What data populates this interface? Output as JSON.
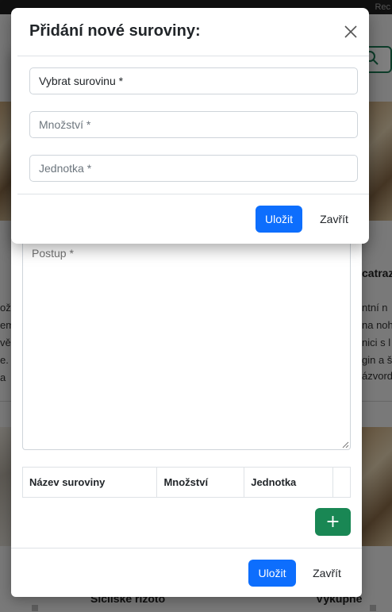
{
  "background": {
    "topbar_text": "Rec",
    "snippets": [
      "ože",
      "em",
      "vě",
      "e.",
      "a",
      "catraz",
      "ntní n",
      "na noh",
      "nici s l",
      "gin a š",
      "ázvord",
      "Sicilské rizoto",
      "Výkupné"
    ]
  },
  "ingredient_modal": {
    "title": "Přidání nové suroviny:",
    "close_icon": "close-icon",
    "fields": {
      "ingredient_select": "Vybrat surovinu *",
      "amount_placeholder": "Množství *",
      "unit_placeholder": "Jednotka *"
    },
    "save_label": "Uložit",
    "close_label": "Zavřít"
  },
  "recipe_modal": {
    "postup_placeholder": "Postup *",
    "table_headers": [
      "Název suroviny",
      "Množství",
      "Jednotka",
      ""
    ],
    "add_button_label": "+",
    "save_label": "Uložit",
    "close_label": "Zavřít"
  },
  "colors": {
    "primary": "#0d6efd",
    "success": "#198754",
    "backdrop": "rgba(0,0,0,0.5)"
  }
}
